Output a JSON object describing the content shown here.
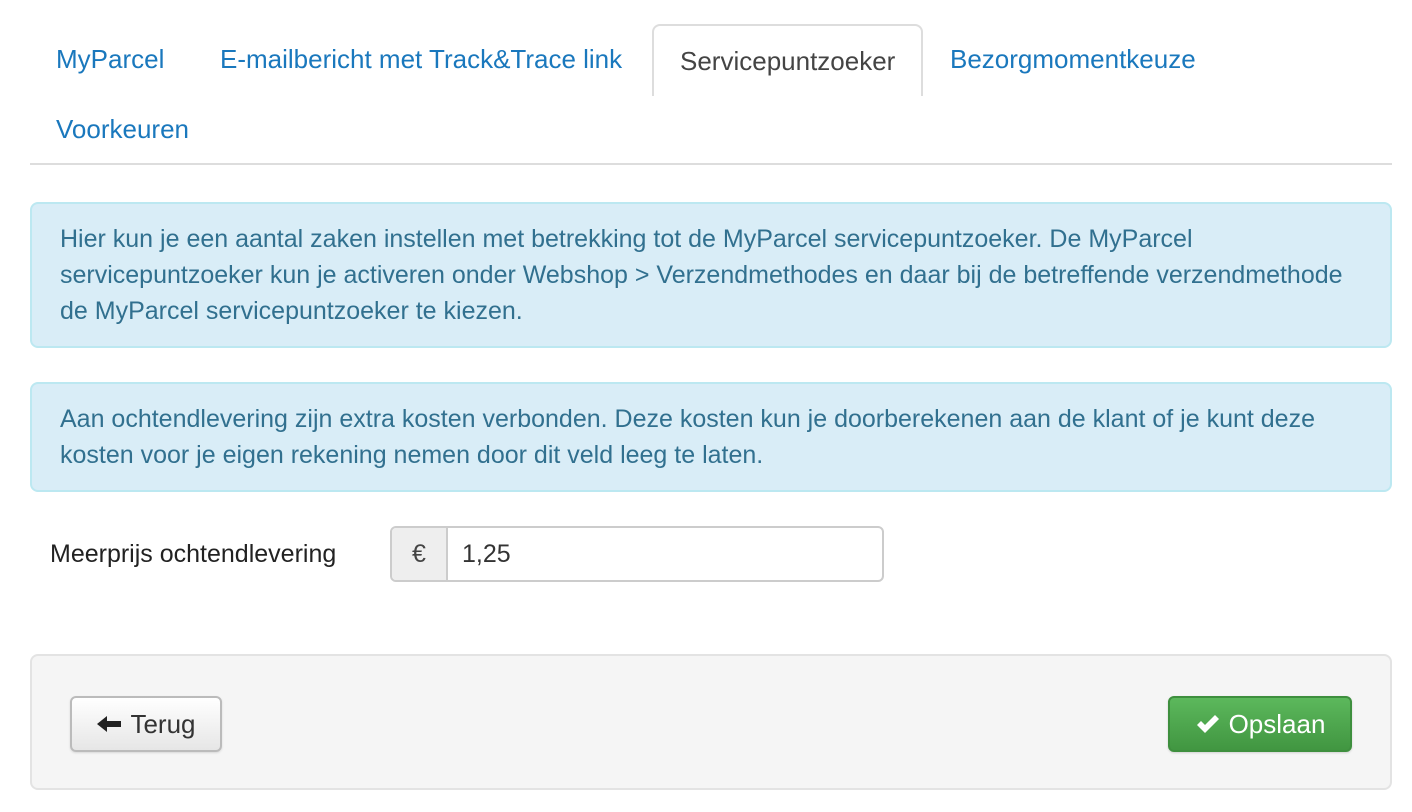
{
  "tabs": [
    {
      "label": "MyParcel"
    },
    {
      "label": "E-mailbericht met Track&Trace link"
    },
    {
      "label": "Servicepuntzoeker",
      "active": true
    },
    {
      "label": "Bezorgmomentkeuze"
    },
    {
      "label": "Voorkeuren"
    }
  ],
  "alerts": {
    "info_servicepoint": "Hier kun je een aantal zaken instellen met betrekking tot de MyParcel servicepuntzoeker. De MyParcel servicepuntzoeker kun je activeren onder Webshop > Verzendmethodes en daar bij de betreffende verzendmethode de MyParcel servicepuntzoeker te kiezen.",
    "info_morning": "Aan ochtendlevering zijn extra kosten verbonden. Deze kosten kun je doorberekenen aan de klant of je kunt deze kosten voor je eigen rekening nemen door dit veld leeg te laten."
  },
  "form": {
    "surcharge_label": "Meerprijs ochtendlevering",
    "currency_symbol": "€",
    "surcharge_value": "1,25"
  },
  "footer": {
    "back_label": "Terug",
    "save_label": "Opslaan"
  },
  "icons": {
    "back": "arrow-left-icon",
    "save": "checkmark-icon"
  },
  "colors": {
    "link": "#1a78bd",
    "alert_bg": "#d9edf7",
    "alert_text": "#31708f",
    "save_button": "#4cae4c"
  }
}
